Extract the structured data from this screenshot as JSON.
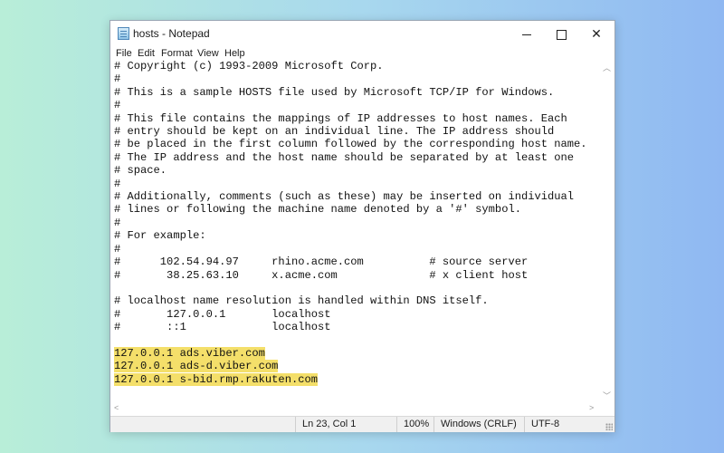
{
  "window": {
    "title": "hosts - Notepad",
    "icon": "notepad-icon"
  },
  "menu": {
    "items": [
      "File",
      "Edit",
      "Format",
      "View",
      "Help"
    ]
  },
  "editor": {
    "lines": [
      "# Copyright (c) 1993-2009 Microsoft Corp.",
      "#",
      "# This is a sample HOSTS file used by Microsoft TCP/IP for Windows.",
      "#",
      "# This file contains the mappings of IP addresses to host names. Each",
      "# entry should be kept on an individual line. The IP address should",
      "# be placed in the first column followed by the corresponding host name.",
      "# The IP address and the host name should be separated by at least one",
      "# space.",
      "#",
      "# Additionally, comments (such as these) may be inserted on individual",
      "# lines or following the machine name denoted by a '#' symbol.",
      "#",
      "# For example:",
      "#",
      "#      102.54.94.97     rhino.acme.com          # source server",
      "#       38.25.63.10     x.acme.com              # x client host",
      "",
      "# localhost name resolution is handled within DNS itself.",
      "#\t127.0.0.1       localhost",
      "#\t::1             localhost",
      "",
      "127.0.0.1 ads.viber.com",
      "127.0.0.1 ads-d.viber.com",
      "127.0.0.1 s-bid.rmp.rakuten.com"
    ],
    "highlighted_lines": [
      22,
      23,
      24
    ],
    "highlight_color": "#f4df6a"
  },
  "status": {
    "position": "Ln 23, Col 1",
    "zoom": "100%",
    "line_ending": "Windows (CRLF)",
    "encoding": "UTF-8"
  },
  "colors": {
    "background_left": "#b8eed8",
    "background_right": "#8fb8f2"
  }
}
